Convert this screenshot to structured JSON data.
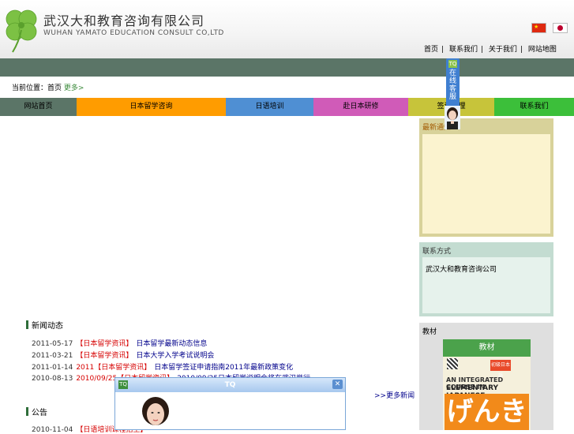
{
  "header": {
    "company_cn": "武汉大和教育咨询有限公司",
    "company_en": "WUHAN YAMATO EDUCATION CONSULT CO,LTD",
    "top_links": [
      "首页",
      "联系我们",
      "关于我们",
      "网站地图"
    ]
  },
  "breadcrumb": {
    "text": "当前位置：首页 ",
    "more": "更多>"
  },
  "nav": {
    "items": [
      {
        "label": "网站首页",
        "color": "#5b7567"
      },
      {
        "label": "日本留学咨询",
        "color": "#ff9c00"
      },
      {
        "label": "日语培训",
        "color": "#4f8fd3"
      },
      {
        "label": "赴日本研修",
        "color": "#d05bb8"
      },
      {
        "label": "签证办理",
        "color": "#c7c43a"
      },
      {
        "label": "联系我们",
        "color": "#3cbf3a"
      }
    ]
  },
  "panels": {
    "notice_title": "最新通知",
    "contact_title": "联系方式",
    "contact_text": "武汉大和教育咨询公司",
    "textbook_section": "教材",
    "textbook_header": "教材"
  },
  "book": {
    "line1": "AN INTEGRATED COURSE IN",
    "line2": "ELEMENTARY JAPANESE",
    "big": "げんき",
    "badge": "初級日本語"
  },
  "news": {
    "title": "新闻动态",
    "items": [
      {
        "date": "2011-05-17",
        "category": "【日本留学资讯】",
        "title": "日本留学最新动态信息"
      },
      {
        "date": "2011-03-21",
        "category": "【日本留学资讯】",
        "title": "日本大学入学考试说明会"
      },
      {
        "date": "2011-01-14",
        "category": "2011【日本留学资讯】",
        "title": "日本留学签证申请指南2011年最新政策变化"
      },
      {
        "date": "2010-08-13",
        "category": "2010/09/25【日本留学资讯】",
        "title": "2010/09/25日本留学说明会将在武汉举行"
      }
    ],
    "more": ">>更多新闻"
  },
  "news2": {
    "title": "公告",
    "items": [
      {
        "date": "2010-11-04",
        "category": "【日语培训课程招生】",
        "title": ""
      }
    ]
  },
  "service": {
    "tab_text": "在线客服",
    "logo": "TQ"
  },
  "tq_popup": {
    "title": "TQ",
    "logo": "TQ",
    "close": "✕"
  }
}
